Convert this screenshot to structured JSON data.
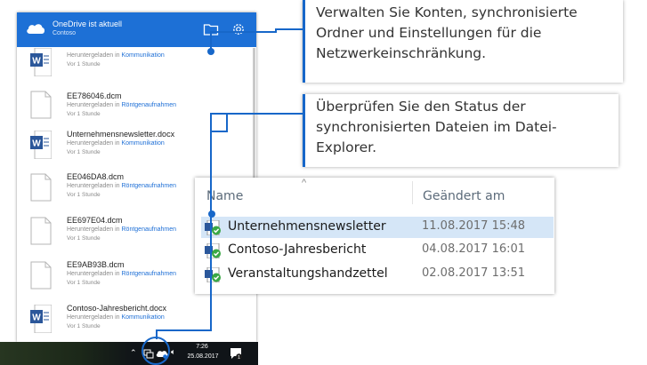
{
  "onedrive": {
    "status_title": "OneDrive ist aktuell",
    "account": "Contoso",
    "icons": {
      "cloud": "cloud-icon",
      "folder": "folder-icon",
      "settings": "gear-icon"
    },
    "files": [
      {
        "name": "",
        "description": "Heruntergeladen in",
        "folder": "Kommunikation",
        "time": "Vor 1 Stunde",
        "type": "word"
      },
      {
        "name": "EE786046.dcm",
        "description": "Heruntergeladen in",
        "folder": "Röntgenaufnahmen",
        "time": "Vor 1 Stunde",
        "type": "file"
      },
      {
        "name": "Unternehmensnewsletter.docx",
        "description": "Heruntergeladen in",
        "folder": "Kommunikation",
        "time": "Vor 1 Stunde",
        "type": "word"
      },
      {
        "name": "EE046DA8.dcm",
        "description": "Heruntergeladen in",
        "folder": "Röntgenaufnahmen",
        "time": "Vor 1 Stunde",
        "type": "file"
      },
      {
        "name": "EE697E04.dcm",
        "description": "Heruntergeladen in",
        "folder": "Röntgenaufnahmen",
        "time": "Vor 1 Stunde",
        "type": "file"
      },
      {
        "name": "EE9AB93B.dcm",
        "description": "Heruntergeladen in",
        "folder": "Röntgenaufnahmen",
        "time": "Vor 1 Stunde",
        "type": "file"
      },
      {
        "name": "Contoso-Jahresbericht.docx",
        "description": "Heruntergeladen in",
        "folder": "Kommunikation",
        "time": "Vor 1 Stunde",
        "type": "word"
      }
    ]
  },
  "taskbar": {
    "time": "7:26",
    "date": "25.08.2017",
    "notification_count": "1",
    "icons": [
      "chevron-up-icon",
      "network-icon",
      "onedrive-icon",
      "volume-icon",
      "action-center-icon"
    ]
  },
  "callouts": {
    "top": "Verwalten Sie Konten, synchronisierte Ordner und Einstellungen für die Netzwerkeinschränkung.",
    "middle": "Überprüfen Sie den Status der synchronisierten Dateien im Datei-Explorer."
  },
  "explorer": {
    "col_name": "Name",
    "col_modified": "Geändert am",
    "rows": [
      {
        "name": "Unternehmensnewsletter",
        "modified": "11.08.2017 15:48",
        "selected": true
      },
      {
        "name": "Contoso-Jahresbericht",
        "modified": "04.08.2017 16:01",
        "selected": false
      },
      {
        "name": "Veranstaltungshandzettel",
        "modified": "02.08.2017 13:51",
        "selected": false
      }
    ]
  },
  "colors": {
    "accent": "#1d70d6",
    "link": "#1e6fd6",
    "callout_line": "#1767c9",
    "selection": "#d5e6f7",
    "sync_check": "#3aa845"
  }
}
